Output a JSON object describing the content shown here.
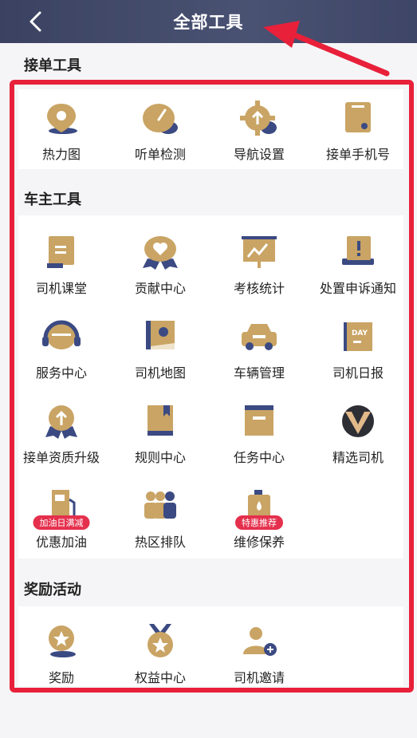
{
  "header": {
    "title": "全部工具",
    "back_label": "<"
  },
  "sections": [
    {
      "title": "接单工具",
      "items": [
        {
          "label": "热力图",
          "icon": "location-pin-icon"
        },
        {
          "label": "听单检测",
          "icon": "gauge-icon"
        },
        {
          "label": "导航设置",
          "icon": "gear-upload-icon"
        },
        {
          "label": "接单手机号",
          "icon": "phone-box-icon"
        }
      ]
    },
    {
      "title": "车主工具",
      "items": [
        {
          "label": "司机课堂",
          "icon": "book-icon"
        },
        {
          "label": "贡献中心",
          "icon": "heart-badge-icon"
        },
        {
          "label": "考核统计",
          "icon": "chart-board-icon"
        },
        {
          "label": "处置申诉通知",
          "icon": "alert-message-icon"
        },
        {
          "label": "服务中心",
          "icon": "headset-icon"
        },
        {
          "label": "司机地图",
          "icon": "map-icon"
        },
        {
          "label": "车辆管理",
          "icon": "car-icon"
        },
        {
          "label": "司机日报",
          "icon": "day-calendar-icon"
        },
        {
          "label": "接单资质升级",
          "icon": "upgrade-badge-icon"
        },
        {
          "label": "规则中心",
          "icon": "rulebook-icon"
        },
        {
          "label": "任务中心",
          "icon": "task-folder-icon"
        },
        {
          "label": "精选司机",
          "icon": "v-logo-icon"
        },
        {
          "label": "优惠加油",
          "icon": "fuel-pump-icon",
          "badge": "加油日满减"
        },
        {
          "label": "热区排队",
          "icon": "people-queue-icon"
        },
        {
          "label": "维修保养",
          "icon": "oil-can-icon",
          "badge": "特惠推荐"
        }
      ]
    },
    {
      "title": "奖励活动",
      "items": [
        {
          "label": "奖励",
          "icon": "star-medal-icon"
        },
        {
          "label": "权益中心",
          "icon": "star-ribbon-icon"
        },
        {
          "label": "司机邀请",
          "icon": "invite-user-icon"
        }
      ]
    }
  ],
  "colors": {
    "header": "#3e4566",
    "gold": "#c9a464",
    "navy": "#3b4a82",
    "frame": "#e8203a",
    "badge": "#e5304d"
  }
}
